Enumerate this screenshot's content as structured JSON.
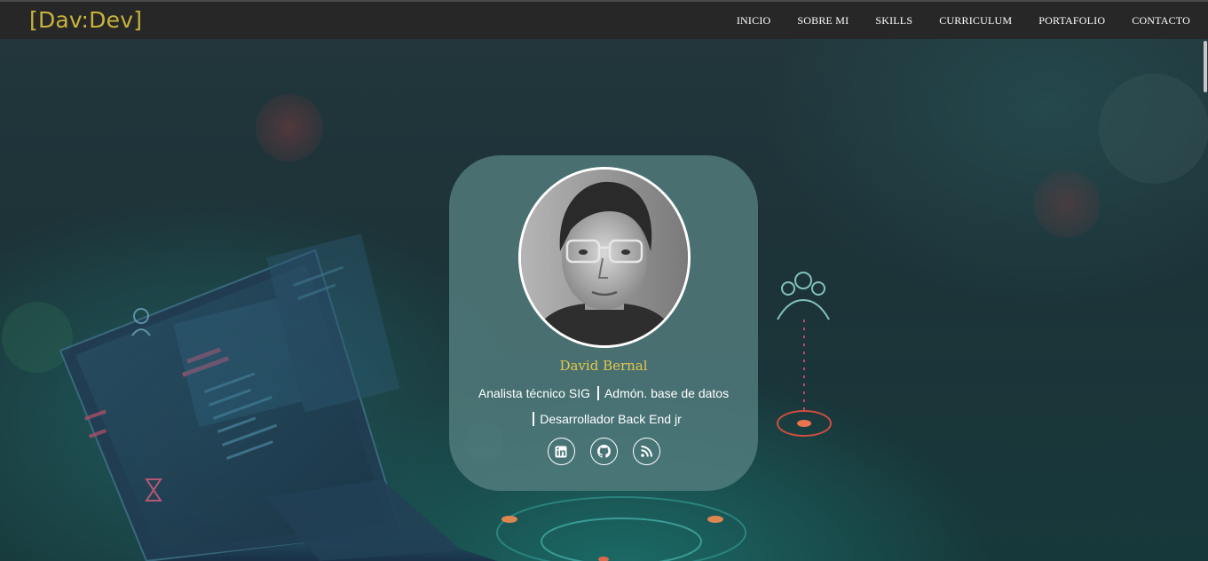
{
  "brand": "[Dav:Dev]",
  "nav": {
    "items": [
      "INICIO",
      "SOBRE MI",
      "SKILLS",
      "CURRICULUM",
      "PORTAFOLIO",
      "CONTACTO"
    ]
  },
  "profile": {
    "name": "David Bernal",
    "role_1": "Analista técnico SIG",
    "role_2": "Admón. base de datos",
    "role_3": "Desarrollador Back End jr",
    "socials": [
      {
        "icon": "linkedin-icon"
      },
      {
        "icon": "github-icon"
      },
      {
        "icon": "rss-icon"
      }
    ]
  },
  "colors": {
    "brand": "#c7b43d",
    "name": "#e2c64a",
    "navbar": "#272727",
    "card": "#568082"
  }
}
